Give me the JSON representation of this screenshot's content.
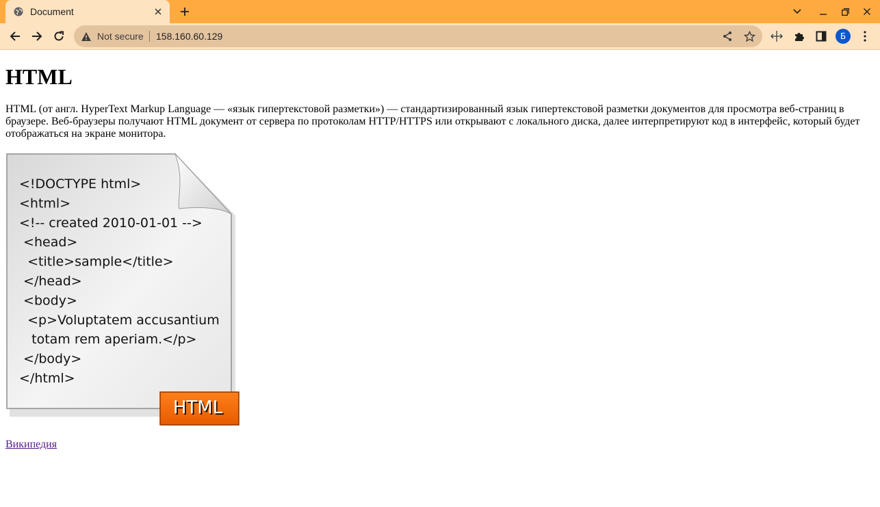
{
  "browser": {
    "tab": {
      "title": "Document",
      "favicon": "globe-icon"
    },
    "omnibox": {
      "security_label": "Not secure",
      "url": "158.160.60.129"
    },
    "profile_initial": "Б",
    "colors": {
      "tabbar": "#ffaa3f",
      "toolbar": "#fee3c1",
      "omnibox": "#e4c49f",
      "avatar": "#0b57d0"
    }
  },
  "page": {
    "heading": "HTML",
    "intro": "HTML (от англ. HyperText Markup Language — «язык гипертекстовой разметки») — стандартизированный язык гипертекстовой разметки документов для просмотра веб-страниц в браузере. Веб-браузеры получают HTML документ от сервера по протоколам HTTP/HTTPS или открывают с локального диска, далее интерпретируют код в интерфейс, который будет отображаться на экране монитора.",
    "figure": {
      "code_lines": [
        "<!DOCTYPE html>",
        "<html>",
        "<!-- created 2010-01-01 -->",
        " <head>",
        "  <title>sample</title>",
        " </head>",
        " <body>",
        "  <p>Voluptatem accusantium",
        "   totam rem aperiam.</p>",
        " </body>",
        "</html>"
      ],
      "badge": "HTML",
      "badge_color": "#ff6a00"
    },
    "link": "Википедия"
  }
}
